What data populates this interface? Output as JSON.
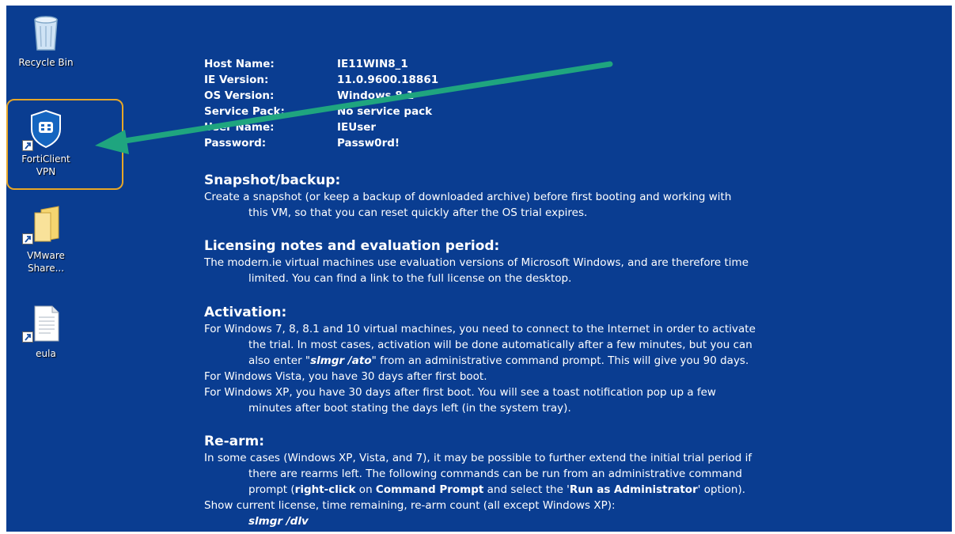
{
  "desktop_icons": [
    {
      "label": "Recycle Bin"
    },
    {
      "label": "FortiClient VPN"
    },
    {
      "label": "VMware Share..."
    },
    {
      "label": "eula"
    }
  ],
  "colors": {
    "desktop": "#0a3d91",
    "highlight": "#e7a728",
    "arrow": "#1fa57f"
  },
  "info": {
    "host_name_label": "Host Name:",
    "host_name": "IE11WIN8_1",
    "ie_version_label": "IE Version:",
    "ie_version": "11.0.9600.18861",
    "os_version_label": "OS Version:",
    "os_version": "Windows 8.1",
    "service_pack_label": "Service Pack:",
    "service_pack": "No service pack",
    "user_name_label": "User Name:",
    "user_name": "IEUser",
    "password_label": "Password:",
    "password": "Passw0rd!"
  },
  "sections": {
    "snapshot": {
      "title": "Snapshot/backup:",
      "p1a": "Create a snapshot (or keep a backup of downloaded archive) before first booting and working with",
      "p1b": "this VM, so that you can reset quickly after the OS trial expires."
    },
    "licensing": {
      "title": "Licensing notes and evaluation period:",
      "p1a": "The modern.ie virtual machines use evaluation versions of Microsoft Windows, and are therefore time",
      "p1b": "limited. You can find a link to the full license on the desktop."
    },
    "activation": {
      "title": "Activation:",
      "l1": "For Windows 7, 8, 8.1 and 10 virtual machines, you need to connect to the Internet in order to activate",
      "l2": "the trial. In most cases, activation will be done automatically after a few minutes, but you can",
      "l3_pre": "also enter \"",
      "l3_cmd": "slmgr /ato",
      "l3_post": "\" from an administrative command prompt. This will give you 90 days.",
      "l4": "For Windows Vista, you have 30 days after first boot.",
      "l5": "For Windows XP, you have 30 days after first boot. You will see a toast notification pop up a few",
      "l6": "minutes after boot stating the days left (in the system tray)."
    },
    "rearm": {
      "title": "Re-arm:",
      "l1": "In some cases (Windows XP, Vista, and 7), it may be possible to further extend the initial trial period if",
      "l2": "there are rearms left. The following commands can be run from an administrative command",
      "l3_pre": "prompt (",
      "l3_b1": "right-click",
      "l3_mid1": " on ",
      "l3_b2": "Command Prompt",
      "l3_mid2": " and select the '",
      "l3_b3": "Run as Administrator",
      "l3_post": "' option).",
      "l4": "Show current license, time remaining, re-arm count (all except Windows XP):",
      "l5": "slmgr /dlv"
    }
  }
}
